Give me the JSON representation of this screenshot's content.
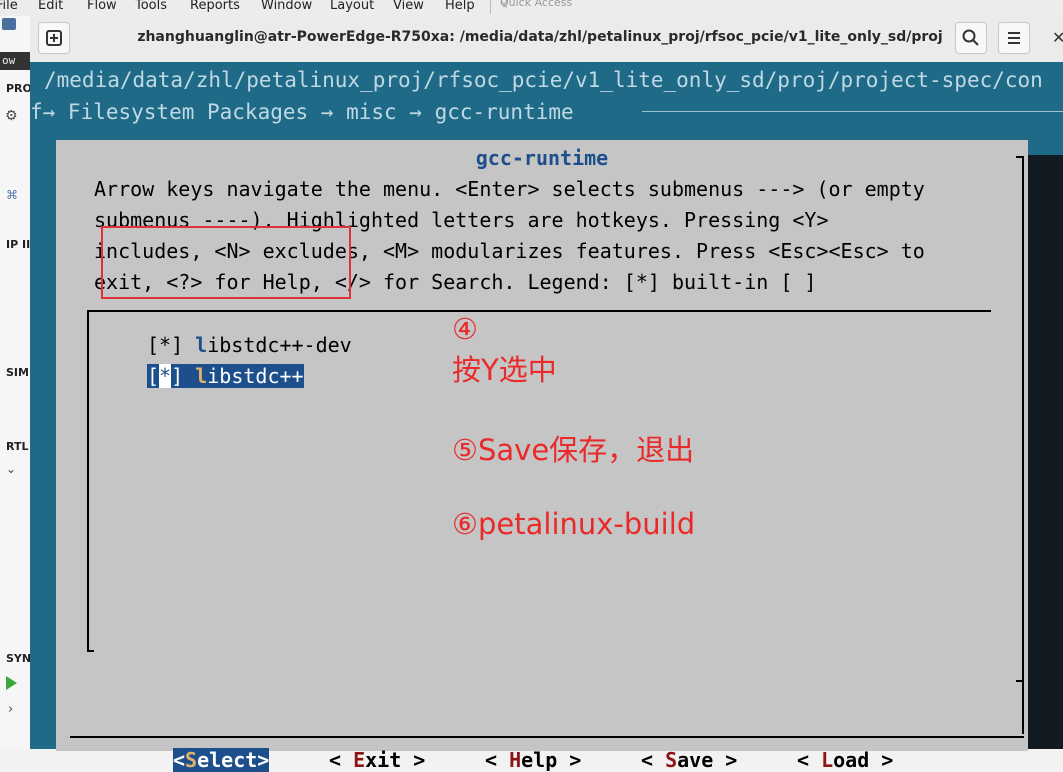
{
  "ide": {
    "menu": [
      "File",
      "Edit",
      "Flow",
      "Tools",
      "Reports",
      "Window",
      "Layout",
      "View",
      "Help"
    ],
    "quick_access": "Quick Access",
    "left_labels": [
      "ow",
      "PRO",
      "IP II",
      "SIMU",
      "RTL",
      "SYN"
    ]
  },
  "terminal": {
    "title": "zhanghuanglin@atr-PowerEdge-R750xa: /media/data/zhl/petalinux_proj/rfsoc_pcie/v1_lite_only_sd/proj",
    "path": "/media/data/zhl/petalinux_proj/rfsoc_pcie/v1_lite_only_sd/proj/project-spec/con",
    "breadcrumb": "f→ Filesystem Packages  → misc  → gcc-runtime"
  },
  "dialog": {
    "title": "gcc-runtime",
    "help_lines": [
      "Arrow keys navigate the menu.  <Enter> selects submenus ---> (or empty",
      "submenus ----).  Highlighted letters are hotkeys.  Pressing <Y>",
      "includes, <N> excludes, <M> modularizes features.  Press <Esc><Esc> to",
      "exit, <?> for Help, </> for Search.  Legend: [*] built-in  [ ]"
    ],
    "items": [
      {
        "check": "[*]",
        "hotkey": "l",
        "rest": "ibstdc++-dev",
        "selected": false
      },
      {
        "check_open": "[",
        "check_mark": "*",
        "check_close": "]",
        "hotkey": "l",
        "rest": "ibstdc++",
        "selected": true
      }
    ],
    "buttons": [
      {
        "pre": "<",
        "hotkey": "S",
        "rest": "elect>",
        "active": true
      },
      {
        "pre": "< ",
        "hotkey": "E",
        "rest": "xit >",
        "active": false
      },
      {
        "pre": "< ",
        "hotkey": "H",
        "rest": "elp >",
        "active": false
      },
      {
        "pre": "< ",
        "hotkey": "S",
        "rest": "ave >",
        "active": false
      },
      {
        "pre": "< ",
        "hotkey": "L",
        "rest": "oad >",
        "active": false
      }
    ]
  },
  "annotations": {
    "step4_num": "④",
    "step4_text": "按Y选中",
    "step5": "⑤Save保存，退出",
    "step6": "⑥petalinux-build"
  },
  "colors": {
    "terminal_bg": "#1f6b87",
    "dialog_bg": "#c5c5c5",
    "hotkey_blue": "#1d4f8c",
    "button_hotkey_red": "#8e1515",
    "annotation_red": "#ea2a2a"
  }
}
